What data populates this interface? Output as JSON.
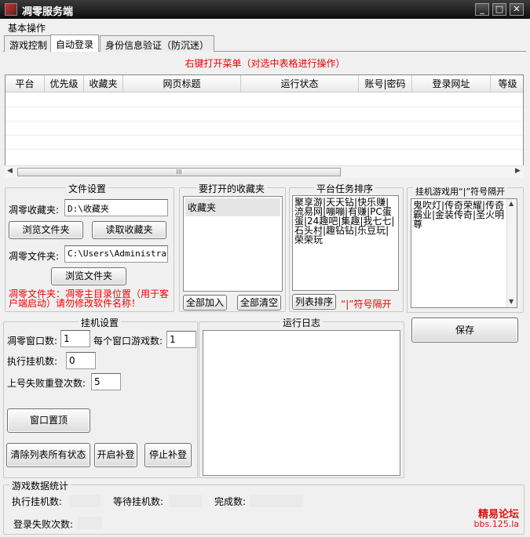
{
  "window": {
    "title": "凋零服务端",
    "min": "_",
    "max": "□",
    "close": "✕"
  },
  "menu": {
    "basic_ops": "基本操作"
  },
  "tabs": [
    {
      "label": "游戏控制"
    },
    {
      "label": "自动登录"
    },
    {
      "label": "身份信息验证（防沉迷）"
    }
  ],
  "hint": "右键打开菜单（对选中表格进行操作）",
  "table": {
    "columns": [
      "平台",
      "优先级",
      "收藏夹",
      "网页标题",
      "运行状态",
      "账号|密码",
      "登录网址",
      "等级"
    ],
    "rows": [],
    "scroll_thumb": "III"
  },
  "file_settings": {
    "title": "文件设置",
    "fav_label": "凋零收藏夹:",
    "fav_value": "D:\\收藏夹",
    "browse_folder": "浏览文件夹",
    "read_fav": "读取收藏夹",
    "file_label": "凋零文件夹:",
    "file_value": "C:\\Users\\Administrato",
    "browse_file": "浏览文件夹",
    "warning": "凋零文件夹：凋零主目录位置（用于客户端启动）请勿修改软件名称！"
  },
  "fav_open": {
    "title": "要打开的收藏夹",
    "items": [
      "收藏夹"
    ],
    "add_all": "全部加入",
    "clear_all": "全部清空"
  },
  "platform_sort": {
    "title": "平台任务排序",
    "text": "聚享游|天天钻|快乐赚|流易网|嘣嘣|有赚|PC蛋蛋|24趣吧|集趣|我七七|石头村|趣钻钻|乐豆玩|荣荣玩",
    "sort_button": "列表排序",
    "note": "“|”符号隔开"
  },
  "hang_games": {
    "title": "挂机游戏用“|”符号隔开",
    "text": "鬼吹灯|传奇荣耀|传奇霸业|金装传奇|圣火明尊",
    "save": "保存"
  },
  "hang_settings": {
    "title": "挂机设置",
    "window_count_label": "凋零窗口数:",
    "window_count": "1",
    "games_per_window_label": "每个窗口游戏数:",
    "games_per_window": "1",
    "exec_label": "执行挂机数:",
    "exec_value": "0",
    "retry_label": "上号失败重登次数:",
    "retry_value": "5",
    "pin_window": "窗口置顶",
    "clear_status": "清除列表所有状态",
    "start_fill": "开启补登",
    "stop_fill": "停止补登"
  },
  "run_log": {
    "title": "运行日志"
  },
  "stats": {
    "title": "游戏数据统计",
    "executing": "执行挂机数:",
    "waiting": "等待挂机数:",
    "done": "完成数:",
    "login_fail": "登录失败次数:"
  },
  "watermark": {
    "line1": "精易论坛",
    "line2": "bbs.125.la"
  },
  "colors": {
    "accent_red": "#ee0000",
    "titlebar": "#1a1a1a"
  }
}
